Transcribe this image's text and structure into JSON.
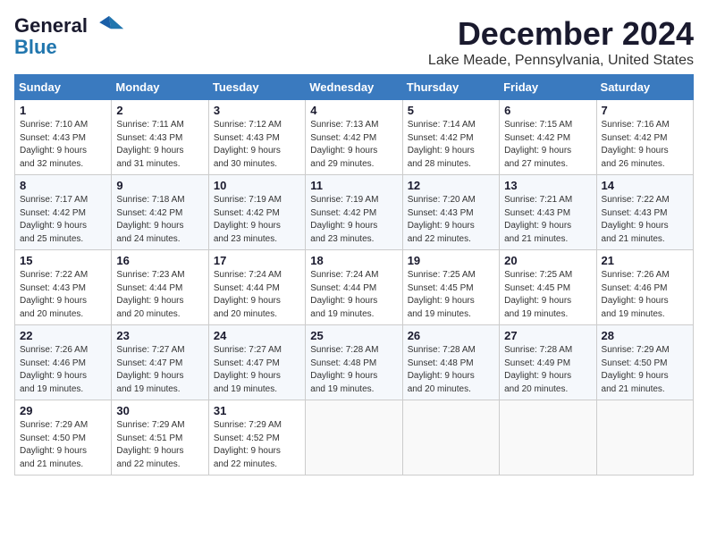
{
  "logo": {
    "line1": "General",
    "line2": "Blue",
    "icon_color": "#2176ae"
  },
  "title": "December 2024",
  "subtitle": "Lake Meade, Pennsylvania, United States",
  "header_accent": "#3a7abf",
  "days_of_week": [
    "Sunday",
    "Monday",
    "Tuesday",
    "Wednesday",
    "Thursday",
    "Friday",
    "Saturday"
  ],
  "weeks": [
    [
      {
        "day": "1",
        "info": "Sunrise: 7:10 AM\nSunset: 4:43 PM\nDaylight: 9 hours\nand 32 minutes."
      },
      {
        "day": "2",
        "info": "Sunrise: 7:11 AM\nSunset: 4:43 PM\nDaylight: 9 hours\nand 31 minutes."
      },
      {
        "day": "3",
        "info": "Sunrise: 7:12 AM\nSunset: 4:43 PM\nDaylight: 9 hours\nand 30 minutes."
      },
      {
        "day": "4",
        "info": "Sunrise: 7:13 AM\nSunset: 4:42 PM\nDaylight: 9 hours\nand 29 minutes."
      },
      {
        "day": "5",
        "info": "Sunrise: 7:14 AM\nSunset: 4:42 PM\nDaylight: 9 hours\nand 28 minutes."
      },
      {
        "day": "6",
        "info": "Sunrise: 7:15 AM\nSunset: 4:42 PM\nDaylight: 9 hours\nand 27 minutes."
      },
      {
        "day": "7",
        "info": "Sunrise: 7:16 AM\nSunset: 4:42 PM\nDaylight: 9 hours\nand 26 minutes."
      }
    ],
    [
      {
        "day": "8",
        "info": "Sunrise: 7:17 AM\nSunset: 4:42 PM\nDaylight: 9 hours\nand 25 minutes."
      },
      {
        "day": "9",
        "info": "Sunrise: 7:18 AM\nSunset: 4:42 PM\nDaylight: 9 hours\nand 24 minutes."
      },
      {
        "day": "10",
        "info": "Sunrise: 7:19 AM\nSunset: 4:42 PM\nDaylight: 9 hours\nand 23 minutes."
      },
      {
        "day": "11",
        "info": "Sunrise: 7:19 AM\nSunset: 4:42 PM\nDaylight: 9 hours\nand 23 minutes."
      },
      {
        "day": "12",
        "info": "Sunrise: 7:20 AM\nSunset: 4:43 PM\nDaylight: 9 hours\nand 22 minutes."
      },
      {
        "day": "13",
        "info": "Sunrise: 7:21 AM\nSunset: 4:43 PM\nDaylight: 9 hours\nand 21 minutes."
      },
      {
        "day": "14",
        "info": "Sunrise: 7:22 AM\nSunset: 4:43 PM\nDaylight: 9 hours\nand 21 minutes."
      }
    ],
    [
      {
        "day": "15",
        "info": "Sunrise: 7:22 AM\nSunset: 4:43 PM\nDaylight: 9 hours\nand 20 minutes."
      },
      {
        "day": "16",
        "info": "Sunrise: 7:23 AM\nSunset: 4:44 PM\nDaylight: 9 hours\nand 20 minutes."
      },
      {
        "day": "17",
        "info": "Sunrise: 7:24 AM\nSunset: 4:44 PM\nDaylight: 9 hours\nand 20 minutes."
      },
      {
        "day": "18",
        "info": "Sunrise: 7:24 AM\nSunset: 4:44 PM\nDaylight: 9 hours\nand 19 minutes."
      },
      {
        "day": "19",
        "info": "Sunrise: 7:25 AM\nSunset: 4:45 PM\nDaylight: 9 hours\nand 19 minutes."
      },
      {
        "day": "20",
        "info": "Sunrise: 7:25 AM\nSunset: 4:45 PM\nDaylight: 9 hours\nand 19 minutes."
      },
      {
        "day": "21",
        "info": "Sunrise: 7:26 AM\nSunset: 4:46 PM\nDaylight: 9 hours\nand 19 minutes."
      }
    ],
    [
      {
        "day": "22",
        "info": "Sunrise: 7:26 AM\nSunset: 4:46 PM\nDaylight: 9 hours\nand 19 minutes."
      },
      {
        "day": "23",
        "info": "Sunrise: 7:27 AM\nSunset: 4:47 PM\nDaylight: 9 hours\nand 19 minutes."
      },
      {
        "day": "24",
        "info": "Sunrise: 7:27 AM\nSunset: 4:47 PM\nDaylight: 9 hours\nand 19 minutes."
      },
      {
        "day": "25",
        "info": "Sunrise: 7:28 AM\nSunset: 4:48 PM\nDaylight: 9 hours\nand 19 minutes."
      },
      {
        "day": "26",
        "info": "Sunrise: 7:28 AM\nSunset: 4:48 PM\nDaylight: 9 hours\nand 20 minutes."
      },
      {
        "day": "27",
        "info": "Sunrise: 7:28 AM\nSunset: 4:49 PM\nDaylight: 9 hours\nand 20 minutes."
      },
      {
        "day": "28",
        "info": "Sunrise: 7:29 AM\nSunset: 4:50 PM\nDaylight: 9 hours\nand 21 minutes."
      }
    ],
    [
      {
        "day": "29",
        "info": "Sunrise: 7:29 AM\nSunset: 4:50 PM\nDaylight: 9 hours\nand 21 minutes."
      },
      {
        "day": "30",
        "info": "Sunrise: 7:29 AM\nSunset: 4:51 PM\nDaylight: 9 hours\nand 22 minutes."
      },
      {
        "day": "31",
        "info": "Sunrise: 7:29 AM\nSunset: 4:52 PM\nDaylight: 9 hours\nand 22 minutes."
      },
      {
        "day": "",
        "info": ""
      },
      {
        "day": "",
        "info": ""
      },
      {
        "day": "",
        "info": ""
      },
      {
        "day": "",
        "info": ""
      }
    ]
  ]
}
